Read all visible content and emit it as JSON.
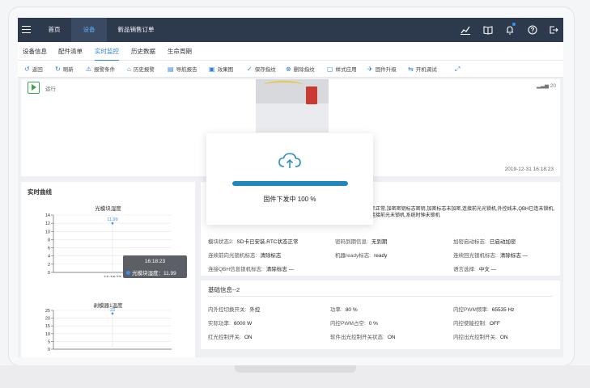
{
  "nav": {
    "items": [
      {
        "label": "首页",
        "active": false
      },
      {
        "label": "设备",
        "active": true
      },
      {
        "label": "新品销售订单",
        "active": false
      }
    ],
    "icons": [
      "chart-line-icon",
      "book-icon",
      "bell-icon",
      "help-icon",
      "logout-icon"
    ]
  },
  "tabs": [
    {
      "label": "设备信息",
      "active": false
    },
    {
      "label": "配件清单",
      "active": false
    },
    {
      "label": "实时监控",
      "active": true
    },
    {
      "label": "历史数据",
      "active": false
    },
    {
      "label": "生命周期",
      "active": false
    }
  ],
  "toolbar": [
    {
      "label": "返回",
      "icon": "back-icon"
    },
    {
      "label": "刷新",
      "icon": "refresh-icon"
    },
    {
      "label": "报警条件",
      "icon": "warning-icon"
    },
    {
      "label": "历史报警",
      "icon": "trash-icon"
    },
    {
      "label": "导航报告",
      "icon": "report-icon"
    },
    {
      "label": "效果图",
      "icon": "image-icon"
    },
    {
      "label": "保存指纹",
      "icon": "save-icon"
    },
    {
      "label": "删除指纹",
      "icon": "delete-icon"
    },
    {
      "label": "样式应用",
      "icon": "apply-icon"
    },
    {
      "label": "固件升级",
      "icon": "upgrade-icon"
    },
    {
      "label": "开机调试",
      "icon": "debug-icon"
    },
    {
      "label": "",
      "icon": "expand-icon"
    }
  ],
  "status": {
    "run_label": "运行",
    "signal": "20",
    "timestamp": "2019-12-31 16:18:23"
  },
  "curves": {
    "title": "实时曲线"
  },
  "chart_data": [
    {
      "type": "line",
      "title": "光模块湿度",
      "x": [
        "16:18:23"
      ],
      "series": [
        {
          "values": [
            11.99
          ]
        }
      ],
      "ylim": [
        0,
        14
      ],
      "yticks": [
        0,
        2,
        4,
        6,
        8,
        10,
        12,
        14
      ],
      "data_label": "11.99",
      "tooltip": {
        "time": "16:18:23",
        "label": "光模块湿度：11.99"
      }
    },
    {
      "type": "line",
      "title": "剥模器1温度",
      "x": [],
      "series": [
        {
          "values": [
            23
          ]
        }
      ],
      "ylim": [
        0,
        25
      ],
      "yticks": [
        0,
        5,
        10,
        15,
        20,
        25
      ],
      "data_label": "23"
    }
  ],
  "info1": {
    "warning": "示正常,加密密钥标志密钥,加密标志未加密,连接前光光锁机,外控线未,QBH已连未锁机,连接前光未锁机,系统时钟未锁机",
    "rows": [
      [
        {
          "k": "模块状态2:",
          "v": "SD卡已安装,RTC状态正常"
        },
        {
          "k": "密码到期信息:",
          "v": "无到期"
        },
        {
          "k": "加密启动标志:",
          "v": "已启动加密"
        }
      ],
      [
        {
          "k": "连续前向光锁机标志:",
          "v": "清除标志"
        },
        {
          "k": "机器ready标志:",
          "v": "ready"
        },
        {
          "k": "连续回光锁机标志:",
          "v": "清除标志 —"
        }
      ],
      [
        {
          "k": "连接QBH信息锁机标志:",
          "v": "清除标志 —"
        },
        {
          "k": "",
          "v": ""
        },
        {
          "k": "语言选择:",
          "v": "中文 —"
        }
      ]
    ]
  },
  "info2": {
    "title": "基础信息--2",
    "rows": [
      [
        {
          "k": "内外控切换开关:",
          "v": "外控"
        },
        {
          "k": "功率:",
          "v": "80 %"
        },
        {
          "k": "内控PWM频率:",
          "v": "65535 Hz"
        }
      ],
      [
        {
          "k": "实际功率:",
          "v": "6000 W"
        },
        {
          "k": "内控PWM占空:",
          "v": "0 %"
        },
        {
          "k": "内控使能控制:",
          "v": "OFF"
        }
      ],
      [
        {
          "k": "红光控制开关:",
          "v": "ON"
        },
        {
          "k": "软件出光控制开关状态:",
          "v": "ON"
        },
        {
          "k": "内控出光控制开关:",
          "v": "ON"
        }
      ]
    ]
  },
  "modal": {
    "text": "固件下发中 100 %",
    "progress": 1.0
  },
  "colors": {
    "accent": "#2b7fd9",
    "nav_bg": "#2d3a4d",
    "progress": "#1f88b8",
    "line": "#3b8ff0"
  }
}
